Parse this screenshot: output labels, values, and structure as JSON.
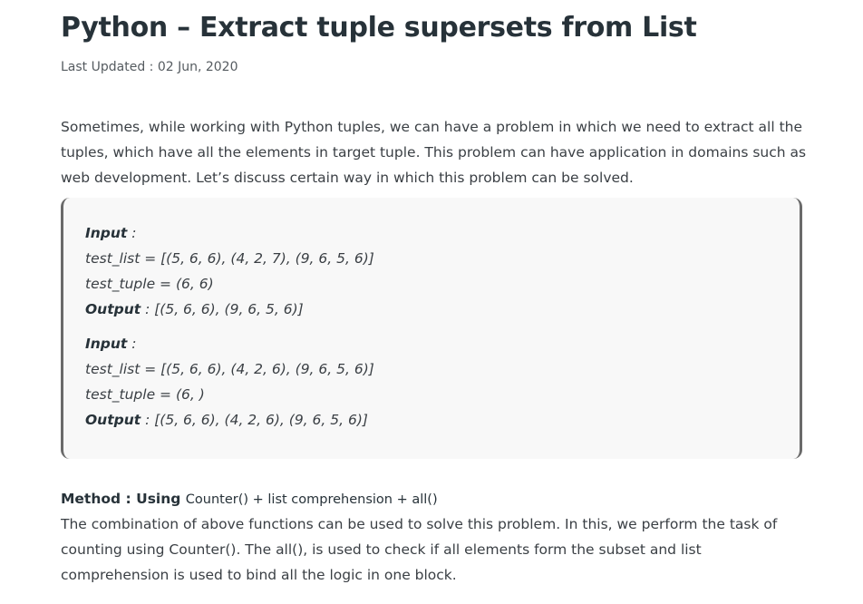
{
  "article": {
    "title": "Python – Extract tuple supersets from List",
    "last_updated": "Last Updated : 02 Jun, 2020",
    "intro": "Sometimes, while working with Python tuples, we can have a problem in which we need to extract all the tuples, which have all the elements in target tuple. This problem can have application in domains such as web development. Let’s discuss certain way in which this problem can be solved.",
    "examples": [
      {
        "input_label": "Input",
        "input_suffix": " :",
        "list_line": "test_list = [(5, 6, 6), (4, 2, 7), (9, 6, 5, 6)]",
        "tuple_line": "test_tuple = (6, 6)",
        "output_label": "Output",
        "output_value": " : [(5, 6, 6), (9, 6, 5, 6)]"
      },
      {
        "input_label": "Input",
        "input_suffix": " :",
        "list_line": "test_list = [(5, 6, 6), (4, 2, 6), (9, 6, 5, 6)]",
        "tuple_line": "test_tuple = (6, )",
        "output_label": "Output",
        "output_value": " : [(5, 6, 6), (4, 2, 6), (9, 6, 5, 6)]"
      }
    ],
    "method": {
      "label": "Method : Using ",
      "technique": "Counter() + list comprehension + all()",
      "description": "The combination of above functions can be used to solve this problem. In this, we perform the task of counting using Counter(). The all(), is used to check if all elements form the subset and list comprehension is used to bind all the logic in one block."
    }
  }
}
